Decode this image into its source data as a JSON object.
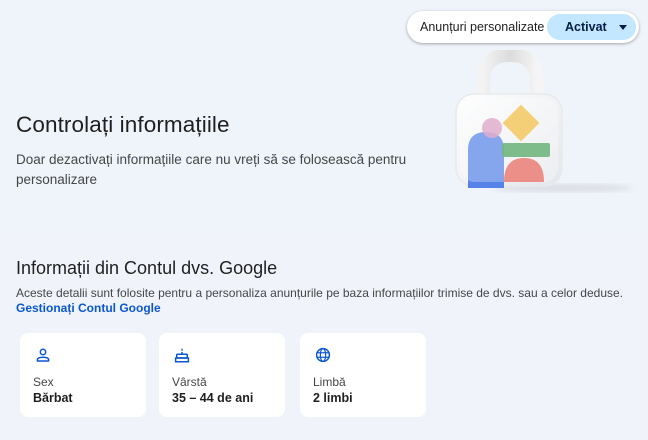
{
  "ads_setting": {
    "label": "Anunțuri personalizate",
    "state": "Activat"
  },
  "hero": {
    "title": "Controlați informațiile",
    "description": "Doar dezactivați informațiile care nu vreți să se folosească pentru personalizare",
    "image": "lock-illustration"
  },
  "account_section": {
    "title": "Informații din Contul dvs. Google",
    "description": "Aceste detalii sunt folosite pentru a personaliza anunțurile pe baza informațiilor trimise de dvs. sau a celor deduse.",
    "manage_link": "Gestionați Contul Google",
    "cards": [
      {
        "icon": "person-icon",
        "label": "Sex",
        "value": "Bărbat"
      },
      {
        "icon": "cake-icon",
        "label": "Vârstă",
        "value": "35 – 44 de ani"
      },
      {
        "icon": "globe-icon",
        "label": "Limbă",
        "value": "2 limbi"
      }
    ]
  },
  "colors": {
    "background": "#eff3fa",
    "accent_pill": "#c2e7ff",
    "link": "#0b57d0",
    "icon": "#0b57d0"
  }
}
